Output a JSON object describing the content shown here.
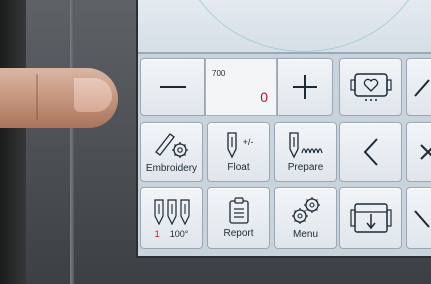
{
  "counter": {
    "max_value": "700",
    "current_value": "0"
  },
  "buttons": {
    "minus_symbol": "—",
    "plus_symbol": "+",
    "embroidery_label": "Embroidery",
    "float_label": "Float",
    "float_symbol": "+/-",
    "prepare_label": "Prepare",
    "needles_count": "1",
    "needles_speed": "100°",
    "report_label": "Report",
    "menu_label": "Menu"
  },
  "icons": {
    "minus": "minus-icon",
    "plus": "plus-icon",
    "hoop": "hoop-heart-icon",
    "up": "chevron-up-icon",
    "left": "chevron-left-icon",
    "close": "close-icon",
    "down": "chevron-down-icon",
    "embroidery": "embroidery-gear-icon",
    "float": "needle-float-icon",
    "prepare": "needle-prepare-icon",
    "needles": "needles-icon",
    "report": "clipboard-icon",
    "menu": "gears-icon",
    "frame": "frame-down-icon"
  },
  "colors": {
    "accent_red": "#c8102e",
    "screen_bg": "#c9d3dc",
    "icon_stroke": "#1d2a36"
  }
}
